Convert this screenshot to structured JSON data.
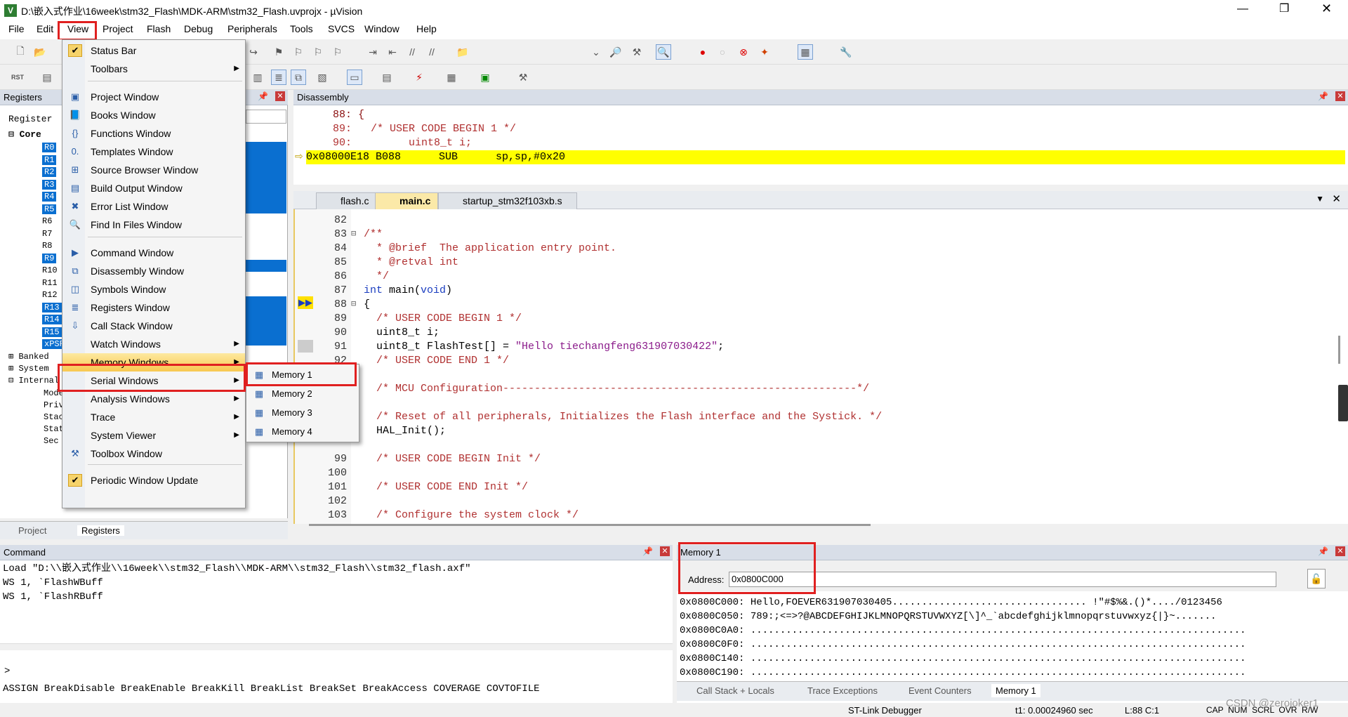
{
  "window": {
    "title": "D:\\嵌入式作业\\16week\\stm32_Flash\\MDK-ARM\\stm32_Flash.uvprojx - µVision",
    "app_icon": "uvision-icon"
  },
  "menubar": [
    "File",
    "Edit",
    "View",
    "Project",
    "Flash",
    "Debug",
    "Peripherals",
    "Tools",
    "SVCS",
    "Window",
    "Help"
  ],
  "view_menu": {
    "items": [
      {
        "label": "Status Bar",
        "icon": "check-icon",
        "checked": true
      },
      {
        "label": "Toolbars",
        "submenu": true
      },
      {
        "label": "Project Window",
        "icon": "project-window-icon"
      },
      {
        "label": "Books Window",
        "icon": "books-icon"
      },
      {
        "label": "Functions Window",
        "icon": "braces-icon"
      },
      {
        "label": "Templates Window",
        "icon": "templates-icon"
      },
      {
        "label": "Source Browser Window",
        "icon": "source-browser-icon"
      },
      {
        "label": "Build Output Window",
        "icon": "build-output-icon"
      },
      {
        "label": "Error List Window",
        "icon": "error-icon"
      },
      {
        "label": "Find In Files Window",
        "icon": "find-icon"
      },
      {
        "label": "Command Window",
        "icon": "command-icon"
      },
      {
        "label": "Disassembly Window",
        "icon": "disassembly-icon"
      },
      {
        "label": "Symbols Window",
        "icon": "symbols-icon"
      },
      {
        "label": "Registers Window",
        "icon": "registers-icon"
      },
      {
        "label": "Call Stack Window",
        "icon": "call-stack-icon"
      },
      {
        "label": "Watch Windows",
        "submenu": true
      },
      {
        "label": "Memory Windows",
        "submenu": true,
        "highlighted": true
      },
      {
        "label": "Serial Windows",
        "submenu": true
      },
      {
        "label": "Analysis Windows",
        "submenu": true
      },
      {
        "label": "Trace",
        "submenu": true
      },
      {
        "label": "System Viewer",
        "submenu": true
      },
      {
        "label": "Toolbox Window",
        "icon": "toolbox-icon"
      },
      {
        "label": "Periodic Window Update",
        "icon": "check-icon",
        "checked": true
      }
    ]
  },
  "memory_submenu": [
    "Memory 1",
    "Memory 2",
    "Memory 3",
    "Memory 4"
  ],
  "registers": {
    "title": "Registers",
    "column": "Register",
    "core_label": "Core",
    "core_regs": [
      "R0",
      "R1",
      "R2",
      "R3",
      "R4",
      "R5",
      "R6",
      "R7",
      "R8",
      "R9",
      "R10",
      "R11",
      "R12",
      "R13",
      "R14",
      "R15",
      "xPSR"
    ],
    "groups": [
      "Banked",
      "System",
      "Internal"
    ],
    "internal_children": [
      "Mode",
      "Privilege",
      "Stack",
      "States",
      "Sec"
    ],
    "tabs": [
      "Project",
      "Registers"
    ]
  },
  "disassembly": {
    "title": "Disassembly",
    "lines": [
      {
        "text": "    88: {"
      },
      {
        "text": "    89:   /* USER CODE BEGIN 1 */"
      },
      {
        "text": "    90:         uint8_t i;"
      },
      {
        "text": "0x08000E18 B088      SUB      sp,sp,#0x20",
        "current": true
      }
    ]
  },
  "editor": {
    "tabs": [
      "flash.c",
      "main.c",
      "startup_stm32f103xb.s"
    ],
    "active_tab": "main.c",
    "lines": [
      {
        "n": "82",
        "t": ""
      },
      {
        "n": "83",
        "t": "/**",
        "c": "cm",
        "fold": "⊟"
      },
      {
        "n": "84",
        "t": "  * @brief  The application entry point.",
        "c": "cm"
      },
      {
        "n": "85",
        "t": "  * @retval int",
        "c": "cm"
      },
      {
        "n": "86",
        "t": "  */",
        "c": "cm"
      },
      {
        "n": "87",
        "t": "int main(void)"
      },
      {
        "n": "88",
        "t": "{",
        "fold": "⊟"
      },
      {
        "n": "89",
        "t": "  /* USER CODE BEGIN 1 */",
        "c": "cm"
      },
      {
        "n": "90",
        "t": "  uint8_t i;"
      },
      {
        "n": "91",
        "t": "  uint8_t FlashTest[] = \"Hello tiechangfeng631907030422\";"
      },
      {
        "n": "92",
        "t": "  /* USER CODE END 1 */",
        "c": "cm"
      },
      {
        "n": "",
        "t": ""
      },
      {
        "n": "",
        "t": "  /* MCU Configuration--------------------------------------------------------*/",
        "c": "cm"
      },
      {
        "n": "",
        "t": ""
      },
      {
        "n": "",
        "t": "  /* Reset of all peripherals, Initializes the Flash interface and the Systick. */",
        "c": "cm"
      },
      {
        "n": "",
        "t": "  HAL_Init();"
      },
      {
        "n": "",
        "t": ""
      },
      {
        "n": "99",
        "t": "  /* USER CODE BEGIN Init */",
        "c": "cm"
      },
      {
        "n": "100",
        "t": ""
      },
      {
        "n": "101",
        "t": "  /* USER CODE END Init */",
        "c": "cm"
      },
      {
        "n": "102",
        "t": ""
      },
      {
        "n": "103",
        "t": "  /* Configure the system clock */",
        "c": "cm"
      }
    ]
  },
  "command": {
    "title": "Command",
    "lines": [
      "Load \"D:\\\\嵌入式作业\\\\16week\\\\stm32_Flash\\\\MDK-ARM\\\\stm32_Flash\\\\stm32_flash.axf\"",
      "WS 1, `FlashWBuff",
      "WS 1, `FlashRBuff"
    ],
    "prompt": ">",
    "keywords": "ASSIGN BreakDisable BreakEnable BreakKill BreakList BreakSet BreakAccess COVERAGE COVTOFILE"
  },
  "memory": {
    "title": "Memory 1",
    "address_label": "Address:",
    "address_value": "0x0800C000",
    "rows": [
      "0x0800C000: Hello,FOEVER631907030405................................. !\"#$%&.()*..../0123456",
      "0x0800C050: 789:;<=>?@ABCDEFGHIJKLMNOPQRSTUVWXYZ[\\]^_`abcdefghijklmnopqrstuvwxyz{|}~.......",
      "0x0800C0A0: ....................................................................................",
      "0x0800C0F0: ....................................................................................",
      "0x0800C140: ....................................................................................",
      "0x0800C190: ...................................................................................."
    ],
    "tabs": [
      "Call Stack + Locals",
      "Trace Exceptions",
      "Event Counters",
      "Memory 1"
    ]
  },
  "status": {
    "debugger": "ST-Link Debugger",
    "time": "t1: 0.00024960 sec",
    "position": "L:88 C:1",
    "indicators": "CAP  NUM  SCRL  OVR  R/W",
    "watermark": "CSDN @zerojoker1"
  }
}
